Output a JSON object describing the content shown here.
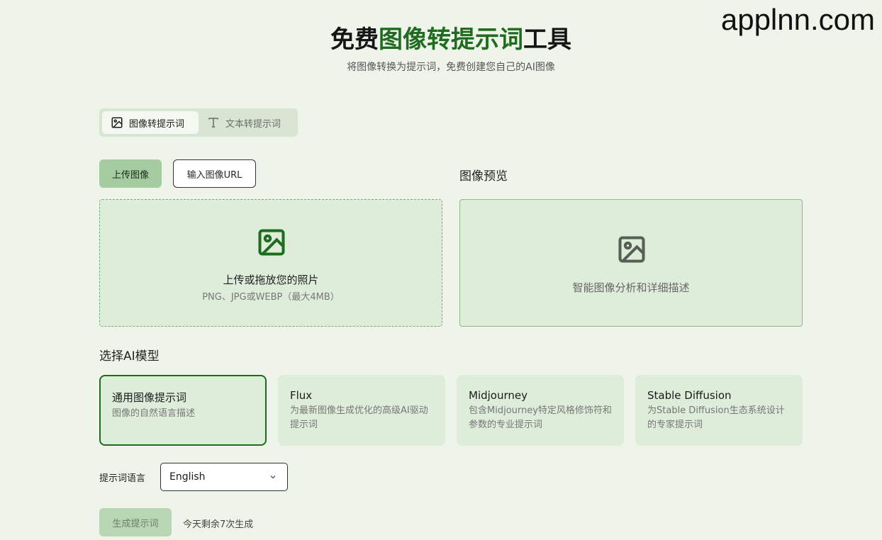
{
  "watermark": "applnn.com",
  "header": {
    "title_prefix": "免费",
    "title_accent": "图像转提示词",
    "title_suffix": "工具",
    "subtitle": "将图像转换为提示词，免费创建您自己的AI图像"
  },
  "tabs": [
    {
      "label": "图像转提示词",
      "icon": "image-icon",
      "active": true
    },
    {
      "label": "文本转提示词",
      "icon": "text-icon",
      "active": false
    }
  ],
  "upload": {
    "upload_button": "上传图像",
    "url_button": "输入图像URL",
    "drop_main": "上传或拖放您的照片",
    "drop_sub": "PNG、JPG或WEBP（最大4MB）"
  },
  "preview": {
    "label": "图像预览",
    "text": "智能图像分析和详细描述"
  },
  "models": {
    "label": "选择AI模型",
    "items": [
      {
        "name": "通用图像提示词",
        "desc": "图像的自然语言描述",
        "selected": true
      },
      {
        "name": "Flux",
        "desc": "为最新图像生成优化的高级AI驱动提示词",
        "selected": false
      },
      {
        "name": "Midjourney",
        "desc": "包含Midjourney特定风格修饰符和参数的专业提示词",
        "selected": false
      },
      {
        "name": "Stable Diffusion",
        "desc": "为Stable Diffusion生态系统设计的专家提示词",
        "selected": false
      }
    ]
  },
  "language": {
    "label": "提示词语言",
    "selected": "English"
  },
  "generate": {
    "button": "生成提示词",
    "remaining": "今天剩余7次生成"
  },
  "colors": {
    "background": "#eef4ea",
    "accent": "#1f6b1f",
    "card": "#deecda"
  }
}
